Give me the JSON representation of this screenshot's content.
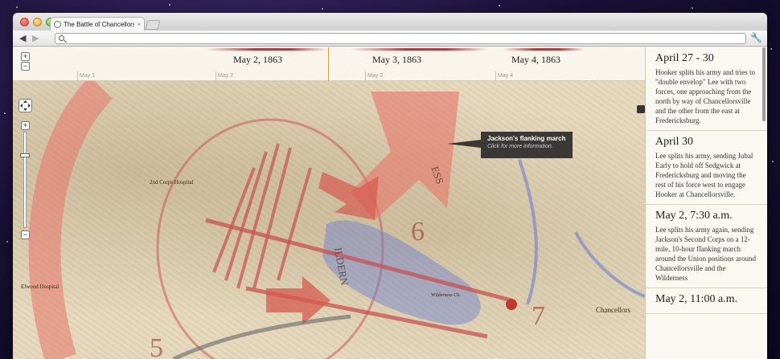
{
  "browser": {
    "tab_title": "The Battle of Chancellorsville",
    "tab_close": "×",
    "back": "◀",
    "forward": "▶",
    "address": ""
  },
  "map": {
    "zoom_in": "+",
    "zoom_out": "−",
    "tooltip": {
      "title": "Jackson's flanking march",
      "subtitle": "Click for more information."
    }
  },
  "timeline": {
    "dates": [
      "May 2, 1863",
      "May 3, 1863",
      "May 4, 1863"
    ],
    "ticks": [
      "May 1",
      "May 2",
      "May 3",
      "May 4"
    ]
  },
  "panel": {
    "entries": [
      {
        "heading": "April 27 - 30",
        "body": "Hooker splits his army and tries to \"double envelop\" Lee with two forces, one approaching from the north by way of Chancellorsville and the other from the east at Fredericksburg."
      },
      {
        "heading": "April 30",
        "body": "Lee splits his army, sending Jubal Early to hold off Sedgwick at Fredericksburg and moving the rest of his force west to engage Hooker at Chancellorsville."
      },
      {
        "heading": "May 2, 7:30 a.m.",
        "body": "Lee splits his army again, sending Jackson's Second Corps on a 12-mile, 10-hour flanking march around the Union positions around Chancellorsville and the Wilderness"
      },
      {
        "heading": "May 2, 11:00 a.m.",
        "body": ""
      }
    ]
  },
  "colors": {
    "confederate": "#c85050",
    "union": "#6b7fd0",
    "paper": "#e6d9bd"
  }
}
